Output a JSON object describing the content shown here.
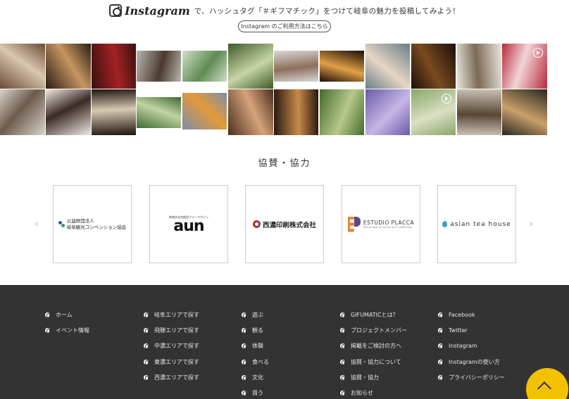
{
  "instagram": {
    "wordmark": "Instagram",
    "tagline": "で、ハッシュタグ「＃ギフマチック」をつけて岐阜の魅力を投稿してみよう！",
    "howto_label": "Instagram のご利用方法はこちら"
  },
  "photos": [
    {
      "c1": "#6b4a35",
      "c2": "#d9c7b0"
    },
    {
      "c1": "#2a1d14",
      "c2": "#c79560"
    },
    {
      "c1": "#3b1010",
      "c2": "#a32222"
    },
    {
      "c1": "#b9b5ad",
      "c2": "#4a3a30"
    },
    {
      "c1": "#cfe0c8",
      "c2": "#5f8a52"
    },
    {
      "c1": "#3e5a2a",
      "c2": "#c7d4a6"
    },
    {
      "c1": "#d8d8d6",
      "c2": "#8d6f5b"
    },
    {
      "c1": "#1a0d08",
      "c2": "#e1a046"
    },
    {
      "c1": "#6b7d8a",
      "c2": "#e6d6c5"
    },
    {
      "c1": "#1c0f08",
      "c2": "#7a4a20"
    },
    {
      "c1": "#e9e5df",
      "c2": "#7b6a54"
    },
    {
      "c1": "#b82a3c",
      "c2": "#f2d5d8"
    },
    {
      "c1": "#d9d4cc",
      "c2": "#6d5c4c"
    },
    {
      "c1": "#efe9e2",
      "c2": "#3a2a24"
    },
    {
      "c1": "#1d1410",
      "c2": "#d8c9b2"
    },
    {
      "c1": "#3f6a31",
      "c2": "#c1d3a2"
    },
    {
      "c1": "#7a8fa8",
      "c2": "#e49a3a"
    },
    {
      "c1": "#4a2e20",
      "c2": "#d6a37a"
    },
    {
      "c1": "#2a1810",
      "c2": "#c68a4a"
    },
    {
      "c1": "#456a2e",
      "c2": "#b5c98a"
    },
    {
      "c1": "#6a5aa8",
      "c2": "#c6b6e6"
    },
    {
      "c1": "#8aa66a",
      "c2": "#d9e0c4"
    },
    {
      "c1": "#c9c2b6",
      "c2": "#5a4636"
    },
    {
      "c1": "#2a2620",
      "c2": "#c8a06a"
    }
  ],
  "sponsors": {
    "title": "協賛・協力",
    "gifu_line1": "公益財団法人",
    "gifu_line2": "岐阜観光コンベンション協会",
    "aun_small": "地域文化共創型フリーマガジン",
    "aun_big": "aun",
    "seino": "西濃印刷株式会社",
    "placca": "ESTUDIO PLACCA",
    "placca_sub": "Bienvenidos al mundo de la creatividad",
    "asian": "asian tea house",
    "prev_arrow": "‹",
    "next_arrow": "›"
  },
  "footer": {
    "col1": [
      "ホーム",
      "イベント情報"
    ],
    "col2": [
      "岐阜エリアで探す",
      "飛騨エリアで探す",
      "中濃エリアで探す",
      "東濃エリアで探す",
      "西濃エリアで探す"
    ],
    "col3": [
      "遊ぶ",
      "観る",
      "体験",
      "食べる",
      "文化",
      "買う"
    ],
    "col4": [
      "GIFUMATICとは？",
      "プロジェクトメンバー",
      "掲載をご検討の方へ",
      "協賛・協力について",
      "協賛・協力",
      "お知らせ"
    ],
    "col5": [
      "Facebook",
      "Twitter",
      "Instagram",
      "Instagramの使い方",
      "プライバシーポリシー"
    ]
  },
  "colors": {
    "footer_bg": "#333333",
    "back_to_top": "#f2c100"
  }
}
